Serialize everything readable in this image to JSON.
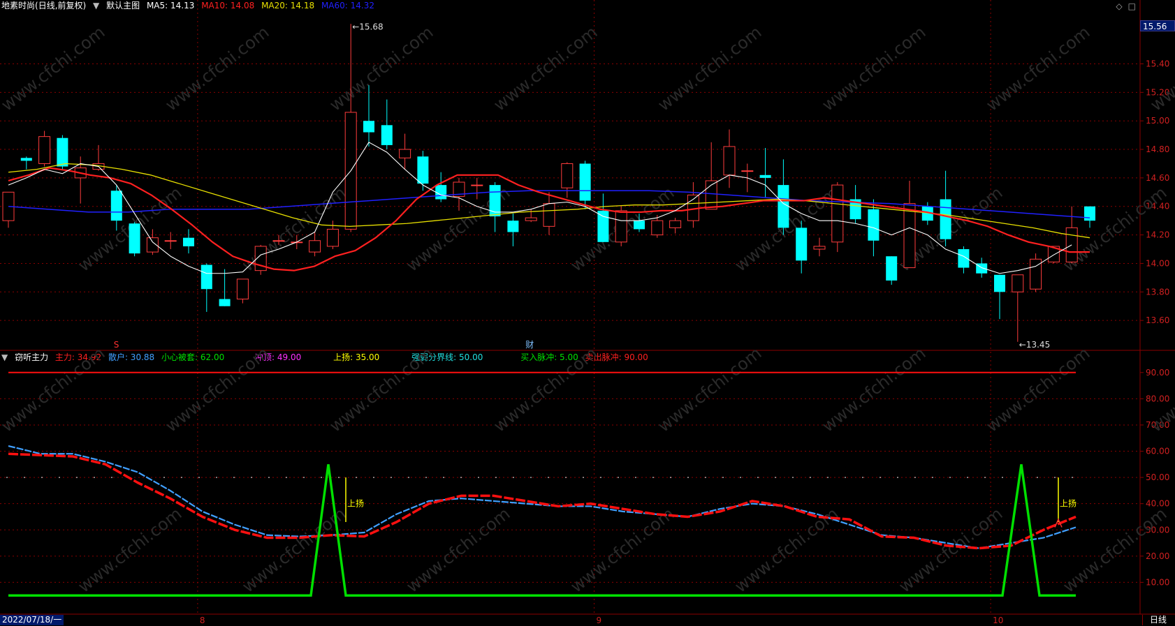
{
  "header": {
    "stock_name": "地素时尚",
    "mode": "(日线,前复权)",
    "chart_name": "默认主图",
    "ma": [
      {
        "label": "MA5: 14.13",
        "color": "#ffffff"
      },
      {
        "label": "MA10: 14.08",
        "color": "#ff2020"
      },
      {
        "label": "MA20: 14.18",
        "color": "#e8e000"
      },
      {
        "label": "MA60: 14.32",
        "color": "#2020ff"
      }
    ]
  },
  "indicator_header": {
    "name": "窃听主力",
    "items": [
      {
        "label": "主力: 34.92",
        "color": "#ff2020"
      },
      {
        "label": "散户: 30.88",
        "color": "#40a0ff"
      },
      {
        "label": "小心被套: 62.00",
        "color": "#00e000"
      },
      {
        "label": "冲顶: 49.00",
        "color": "#ff30ff"
      },
      {
        "label": "上扬: 35.00",
        "color": "#ffff00"
      },
      {
        "label": "强弱分界线: 50.00",
        "color": "#20e0e0"
      },
      {
        "label": "买入脉冲: 5.00",
        "color": "#00e000"
      },
      {
        "label": "卖出脉冲: 90.00",
        "color": "#ff2020"
      }
    ]
  },
  "colors": {
    "up": "#ff3c3c",
    "down": "#00ffff",
    "ma5": "#ffffff",
    "ma10": "#ff2020",
    "ma20": "#e8e000",
    "ma60": "#2020ff",
    "grid": "#8b0000",
    "zhuli": "#ff1010",
    "sanhu": "#40a0ff",
    "pulse": "#00e000",
    "rise": "#ffff00"
  },
  "axis": {
    "price_ticks": [
      "15.40",
      "15.20",
      "15.00",
      "14.80",
      "14.60",
      "14.40",
      "14.20",
      "14.00",
      "13.80",
      "13.60"
    ],
    "price_current": "15.56",
    "ind_ticks": [
      "90.00",
      "80.00",
      "70.00",
      "60.00",
      "50.00",
      "40.00",
      "30.00",
      "20.00",
      "10.00"
    ],
    "months": [
      "8",
      "9",
      "10"
    ],
    "start_date": "2022/07/18/一",
    "period": "日线"
  },
  "annotations": {
    "high": "15.68",
    "low": "13.45",
    "rise_label": "上扬",
    "event_s": "S",
    "event_cai": "财"
  },
  "watermark": "www.cfchi.com",
  "chart_data": [
    {
      "type": "candlestick",
      "ylim": [
        13.4,
        15.75
      ],
      "candles": [
        [
          14.3,
          14.5,
          14.25,
          14.49
        ],
        [
          14.74,
          14.72,
          14.66,
          14.75
        ],
        [
          14.7,
          14.89,
          14.68,
          14.93
        ],
        [
          14.88,
          14.68,
          14.66,
          14.9
        ],
        [
          14.6,
          14.67,
          14.42,
          14.75
        ],
        [
          14.66,
          14.7,
          14.65,
          14.83
        ],
        [
          14.51,
          14.3,
          14.23,
          14.55
        ],
        [
          14.28,
          14.07,
          14.05,
          14.29
        ],
        [
          14.08,
          14.18,
          14.06,
          14.24
        ],
        [
          14.16,
          14.16,
          14.1,
          14.22
        ],
        [
          14.18,
          14.12,
          14.07,
          14.24
        ],
        [
          13.99,
          13.82,
          13.66,
          14.0
        ],
        [
          13.75,
          13.7,
          13.7,
          13.96
        ],
        [
          13.75,
          13.89,
          13.72,
          13.89
        ],
        [
          13.95,
          14.12,
          13.92,
          14.13
        ],
        [
          14.16,
          14.16,
          14.13,
          14.2
        ],
        [
          14.15,
          14.15,
          14.1,
          14.2
        ],
        [
          14.08,
          14.16,
          14.05,
          14.22
        ],
        [
          14.12,
          14.24,
          14.1,
          14.3
        ],
        [
          14.24,
          15.06,
          14.22,
          15.68
        ],
        [
          15.0,
          14.92,
          14.82,
          15.25
        ],
        [
          14.97,
          14.83,
          14.8,
          15.15
        ],
        [
          14.74,
          14.8,
          14.66,
          14.91
        ],
        [
          14.75,
          14.56,
          14.51,
          14.79
        ],
        [
          14.55,
          14.45,
          14.43,
          14.64
        ],
        [
          14.47,
          14.57,
          14.37,
          14.6
        ],
        [
          14.55,
          14.55,
          14.45,
          14.6
        ],
        [
          14.55,
          14.33,
          14.22,
          14.57
        ],
        [
          14.3,
          14.22,
          14.12,
          14.35
        ],
        [
          14.3,
          14.32,
          14.29,
          14.38
        ],
        [
          14.26,
          14.42,
          14.2,
          14.5
        ],
        [
          14.53,
          14.7,
          14.46,
          14.71
        ],
        [
          14.7,
          14.44,
          14.38,
          14.72
        ],
        [
          14.37,
          14.15,
          14.15,
          14.49
        ],
        [
          14.15,
          14.37,
          14.12,
          14.4
        ],
        [
          14.3,
          14.24,
          14.22,
          14.35
        ],
        [
          14.2,
          14.3,
          14.18,
          14.34
        ],
        [
          14.25,
          14.3,
          14.21,
          14.32
        ],
        [
          14.3,
          14.48,
          14.25,
          14.57
        ],
        [
          14.38,
          14.58,
          14.38,
          14.85
        ],
        [
          14.62,
          14.82,
          14.53,
          14.94
        ],
        [
          14.65,
          14.65,
          14.5,
          14.7
        ],
        [
          14.62,
          14.6,
          14.46,
          14.81
        ],
        [
          14.55,
          14.25,
          14.2,
          14.73
        ],
        [
          14.25,
          14.02,
          13.93,
          14.3
        ],
        [
          14.1,
          14.12,
          14.05,
          14.18
        ],
        [
          14.15,
          14.55,
          14.08,
          14.57
        ],
        [
          14.45,
          14.31,
          14.28,
          14.55
        ],
        [
          14.38,
          14.16,
          14.05,
          14.45
        ],
        [
          14.05,
          13.88,
          13.85,
          14.05
        ],
        [
          13.97,
          14.42,
          13.97,
          14.58
        ],
        [
          14.4,
          14.3,
          14.27,
          14.43
        ],
        [
          14.45,
          14.17,
          14.12,
          14.65
        ],
        [
          14.1,
          13.97,
          13.93,
          14.12
        ],
        [
          14.0,
          13.93,
          13.9,
          14.04
        ],
        [
          13.92,
          13.8,
          13.61,
          13.92
        ],
        [
          13.8,
          13.92,
          13.45,
          13.92
        ],
        [
          13.82,
          14.03,
          13.8,
          14.07
        ],
        [
          14.01,
          14.12,
          14.0,
          14.12
        ],
        [
          14.01,
          14.25,
          14.0,
          14.4
        ],
        [
          14.4,
          14.3,
          14.25,
          14.4
        ]
      ],
      "ma5": [
        14.55,
        14.6,
        14.66,
        14.63,
        14.7,
        14.68,
        14.55,
        14.35,
        14.15,
        14.05,
        13.98,
        13.93,
        13.93,
        13.94,
        14.06,
        14.1,
        14.15,
        14.22,
        14.5,
        14.65,
        14.85,
        14.78,
        14.66,
        14.55,
        14.48,
        14.46,
        14.4,
        14.36,
        14.36,
        14.38,
        14.42,
        14.43,
        14.4,
        14.33,
        14.3,
        14.3,
        14.32,
        14.37,
        14.45,
        14.55,
        14.62,
        14.6,
        14.55,
        14.42,
        14.35,
        14.3,
        14.3,
        14.28,
        14.25,
        14.2,
        14.25,
        14.2,
        14.1,
        14.05,
        13.97,
        13.93,
        13.95,
        13.98,
        14.06,
        14.13
      ],
      "ma10": [
        14.58,
        14.62,
        14.67,
        14.65,
        14.62,
        14.6,
        14.56,
        14.48,
        14.38,
        14.27,
        14.15,
        14.05,
        14.0,
        13.96,
        13.95,
        13.98,
        14.05,
        14.09,
        14.18,
        14.3,
        14.45,
        14.55,
        14.62,
        14.62,
        14.62,
        14.55,
        14.5,
        14.46,
        14.42,
        14.38,
        14.36,
        14.36,
        14.37,
        14.37,
        14.39,
        14.4,
        14.42,
        14.44,
        14.44,
        14.44,
        14.46,
        14.44,
        14.42,
        14.4,
        14.38,
        14.36,
        14.33,
        14.3,
        14.26,
        14.2,
        14.15,
        14.12,
        14.08,
        14.08
      ],
      "ma20": [
        14.64,
        14.66,
        14.7,
        14.69,
        14.66,
        14.62,
        14.56,
        14.5,
        14.44,
        14.38,
        14.32,
        14.27,
        14.26,
        14.27,
        14.28,
        14.3,
        14.32,
        14.34,
        14.36,
        14.37,
        14.38,
        14.4,
        14.41,
        14.41,
        14.42,
        14.43,
        14.44,
        14.45,
        14.44,
        14.42,
        14.4,
        14.38,
        14.36,
        14.34,
        14.31,
        14.28,
        14.25,
        14.21,
        14.18
      ],
      "ma60": [
        14.4,
        14.38,
        14.36,
        14.36,
        14.38,
        14.38,
        14.38,
        14.4,
        14.42,
        14.44,
        14.46,
        14.48,
        14.5,
        14.51,
        14.51,
        14.51,
        14.51,
        14.5,
        14.48,
        14.46,
        14.44,
        14.43,
        14.42,
        14.4,
        14.38,
        14.36,
        14.34,
        14.32
      ]
    },
    {
      "type": "line",
      "title": "窃听主力",
      "ylim": [
        0,
        95
      ],
      "series": [
        {
          "name": "主力",
          "values": [
            59,
            58.5,
            58,
            55,
            48,
            42,
            35,
            30,
            27,
            27,
            28,
            27.5,
            33,
            40,
            43,
            43,
            41,
            39,
            40,
            38,
            36,
            35,
            37,
            41,
            39,
            35,
            34,
            27.5,
            27,
            24,
            23,
            24,
            30,
            35
          ]
        },
        {
          "name": "散户",
          "values": [
            62,
            59,
            59,
            56,
            52,
            45,
            37,
            32,
            28,
            27.5,
            28,
            29,
            36,
            41,
            42,
            41,
            40,
            39,
            39,
            37,
            36,
            35,
            38,
            40,
            39,
            36,
            32,
            28,
            27,
            25,
            23,
            25,
            27,
            31
          ]
        },
        {
          "name": "买入脉冲",
          "values": [
            5,
            5,
            5,
            55,
            5,
            5,
            5,
            5,
            5,
            5,
            5,
            5,
            5,
            5,
            5,
            5,
            55,
            5,
            5
          ]
        },
        {
          "name": "卖出脉冲",
          "values": [
            90
          ]
        },
        {
          "name": "强弱分界线",
          "values": [
            50
          ]
        }
      ]
    }
  ]
}
